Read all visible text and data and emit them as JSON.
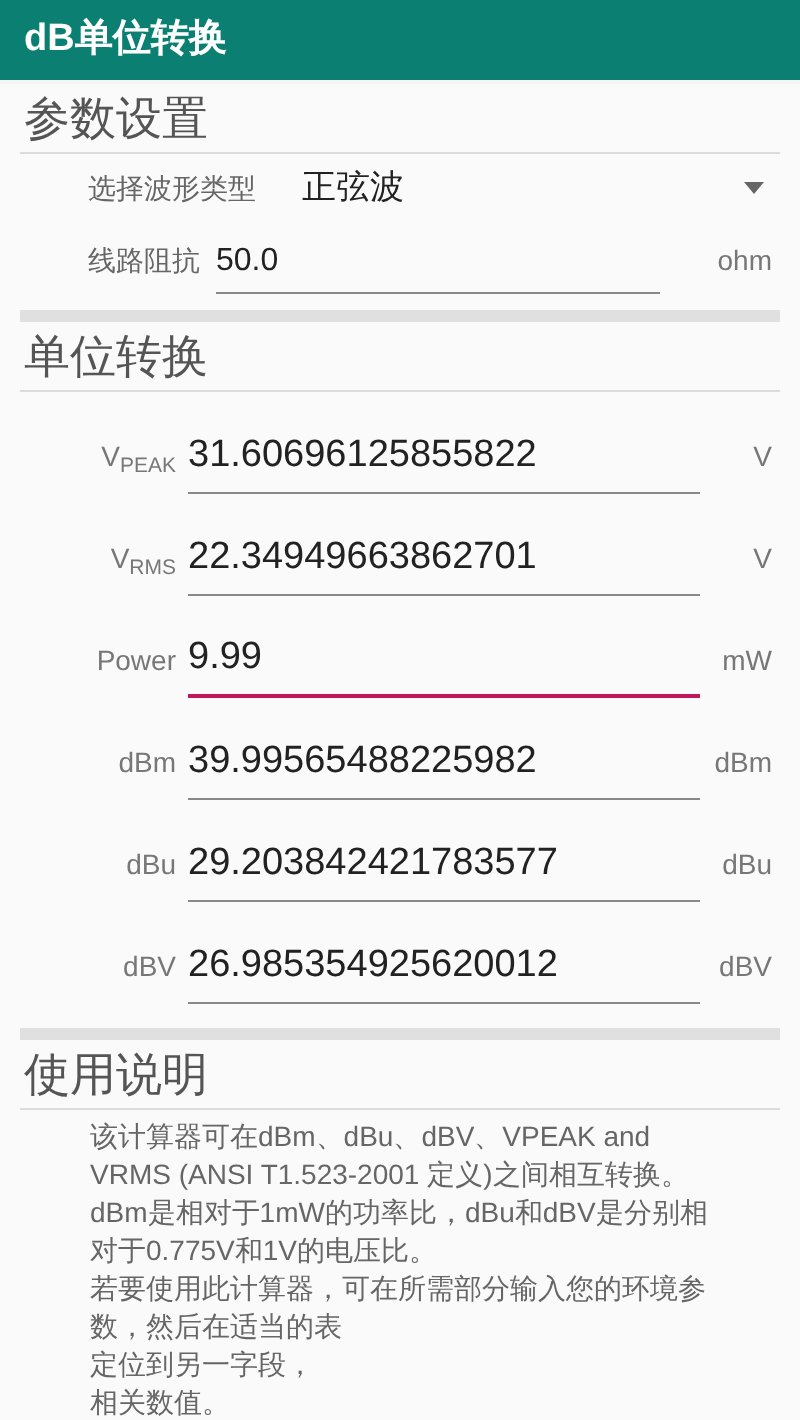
{
  "app_bar": {
    "title": "dB单位转换"
  },
  "settings": {
    "heading": "参数设置",
    "waveform": {
      "label": "选择波形类型",
      "value": "正弦波"
    },
    "impedance": {
      "label": "线路阻抗",
      "value": "50.0",
      "unit": "ohm"
    }
  },
  "conversion": {
    "heading": "单位转换",
    "fields": [
      {
        "label": "V$_{PEAK}$",
        "value": "31.60696125855822",
        "unit": "V",
        "focused": false
      },
      {
        "label": "V$_{RMS}$",
        "value": "22.34949663862701",
        "unit": "V",
        "focused": false
      },
      {
        "label": "Power",
        "value": "9.99",
        "unit": "mW",
        "focused": true
      },
      {
        "label": "dBm",
        "value": "39.99565488225982",
        "unit": "dBm",
        "focused": false
      },
      {
        "label": "dBu",
        "value": "29.203842421783577",
        "unit": "dBu",
        "focused": false
      },
      {
        "label": "dBV",
        "value": "26.985354925620012",
        "unit": "dBV",
        "focused": false
      }
    ]
  },
  "instructions": {
    "heading": "使用说明",
    "lines": [
      "该计算器可在dBm、dBu、dBV、VPEAK and",
      "VRMS (ANSI T1.523-2001 定义)之间相互转换。",
      "dBm是相对于1mW的功率比，dBu和dBV是分别相",
      "对于0.775V和1V的电压比。",
      "若要使用此计算器，可在所需部分输入您的环境参",
      "数，然后在适当的表",
      "定位到另一字段，",
      "相关数值。"
    ]
  }
}
